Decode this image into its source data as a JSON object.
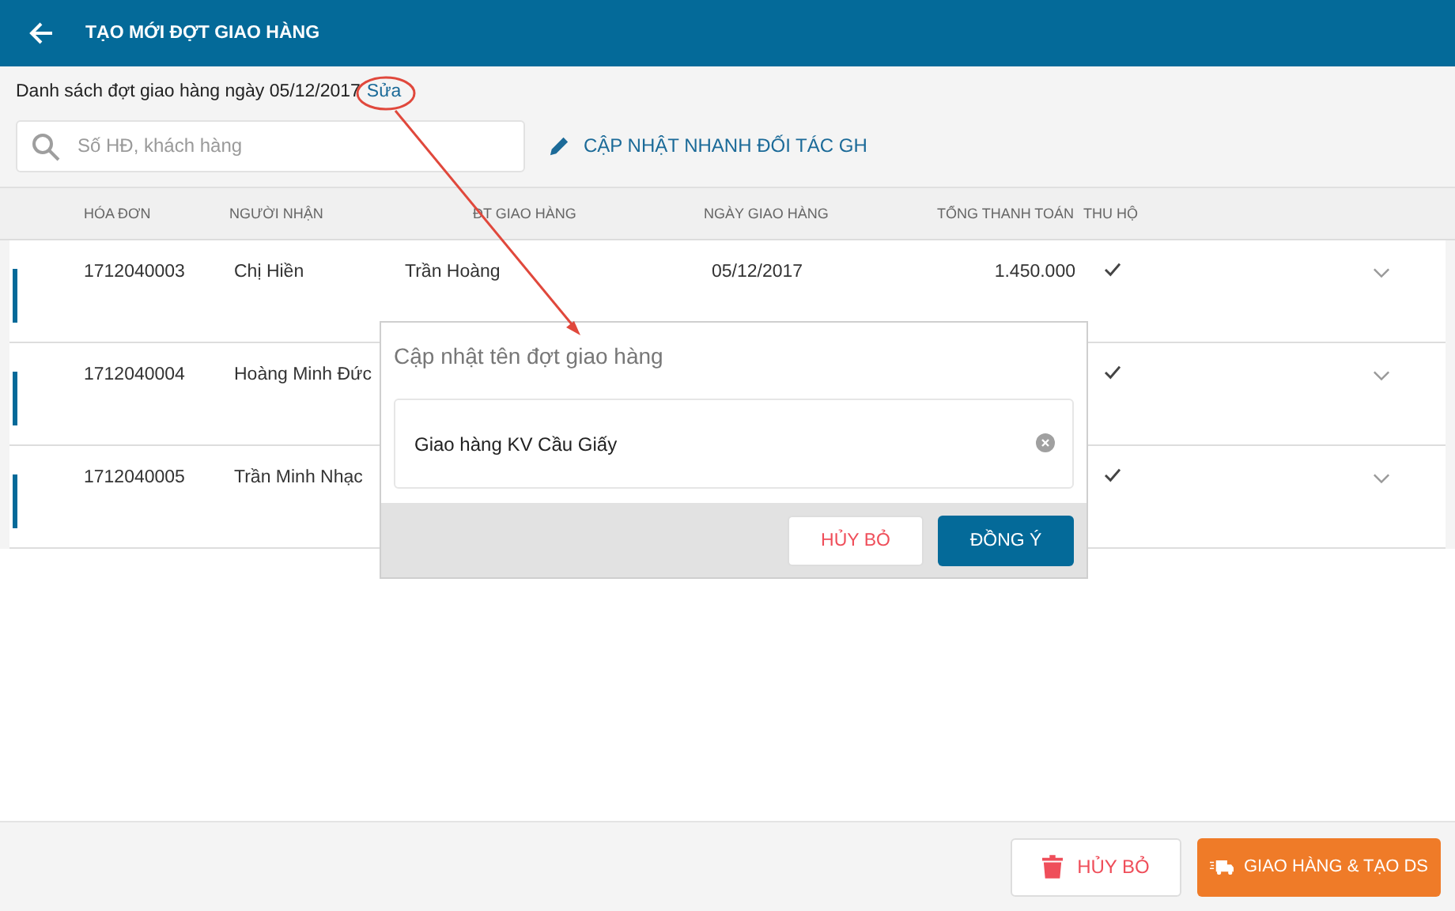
{
  "header": {
    "title": "TẠO MỚI ĐỢT GIAO HÀNG"
  },
  "batch": {
    "label": "Danh sách đợt giao hàng ngày 05/12/2017",
    "edit_link": "Sửa"
  },
  "search": {
    "placeholder": "Số HĐ, khách hàng"
  },
  "quick_update": "CẬP NHẬT NHANH ĐỐI TÁC GH",
  "table": {
    "columns": [
      "HÓA ĐƠN",
      "NGƯỜI NHẬN",
      "ĐT GIAO HÀNG",
      "NGÀY GIAO HÀNG",
      "TỔNG THANH TOÁN",
      "THU HỘ"
    ],
    "rows": [
      {
        "invoice": "1712040003",
        "receiver": "Chị Hiền",
        "delivery": "Trần Hoàng",
        "date": "05/12/2017",
        "total": "1.450.000",
        "cod": true
      },
      {
        "invoice": "1712040004",
        "receiver": "Hoàng Minh Đức",
        "cod": true
      },
      {
        "invoice": "1712040005",
        "receiver": "Trần Minh Nhạc",
        "cod": true
      }
    ]
  },
  "dialog": {
    "title": "Cập nhật tên đợt giao hàng",
    "value": "Giao hàng KV Cầu Giấy",
    "buttons": [
      {
        "label": "HỦY BỎ",
        "kind": "cancel"
      },
      {
        "label": "ĐỒNG Ý",
        "kind": "confirm"
      }
    ]
  },
  "footer": {
    "buttons": [
      {
        "label": "HỦY BỎ",
        "kind": "cancel"
      },
      {
        "label": "GIAO HÀNG & TẠO DS",
        "kind": "confirm"
      }
    ]
  }
}
